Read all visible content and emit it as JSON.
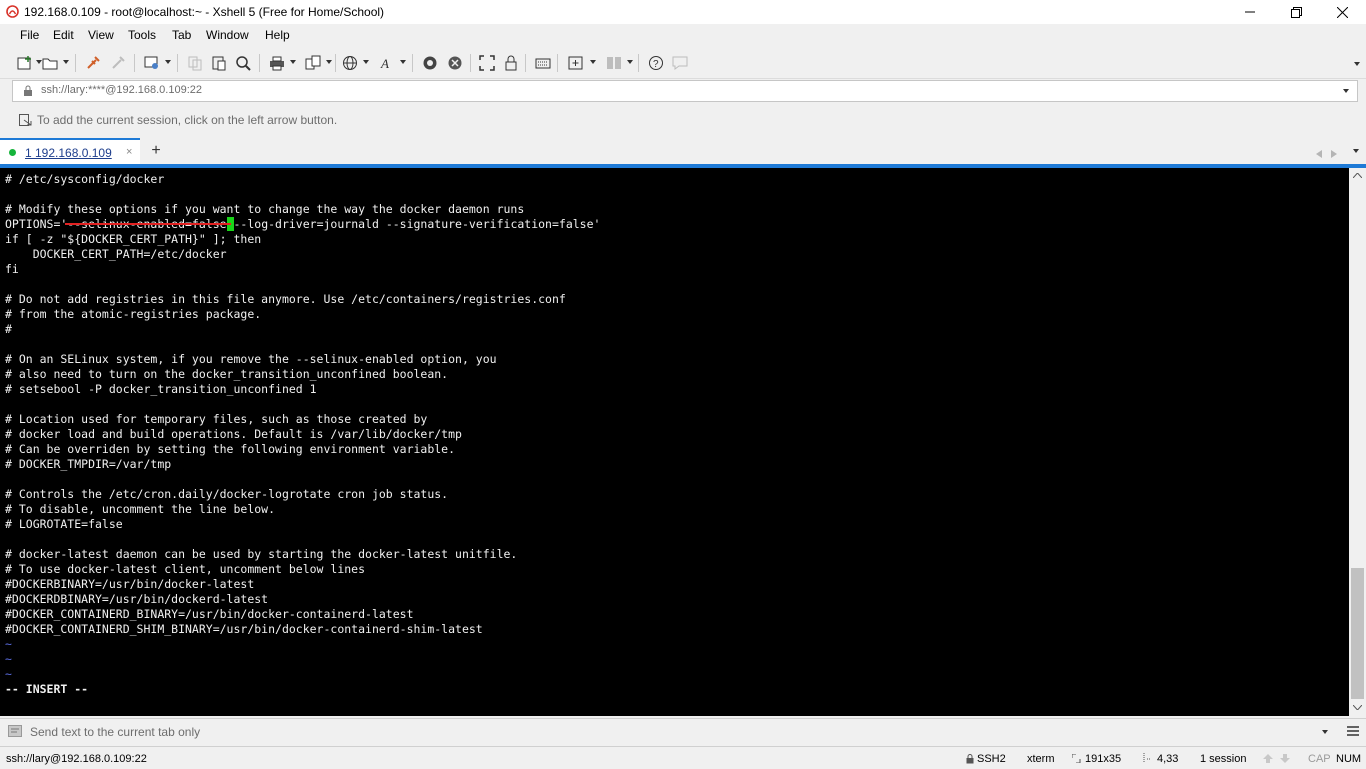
{
  "window": {
    "title": "192.168.0.109 - root@localhost:~ - Xshell 5 (Free for Home/School)"
  },
  "menu": [
    "File",
    "Edit",
    "View",
    "Tools",
    "Tab",
    "Window",
    "Help"
  ],
  "address_bar": {
    "value": "ssh://lary:****@192.168.0.109:22"
  },
  "session_hint": {
    "text": "To add the current session, click on the left arrow button."
  },
  "tabs": [
    {
      "label": "1 192.168.0.109",
      "status_color": "#16b43b"
    }
  ],
  "terminal": {
    "lines": [
      "# /etc/sysconfig/docker",
      "",
      "# Modify these options if you want to change the way the docker daemon runs",
      "OPTIONS='--selinux-enabled=false --log-driver=journald --signature-verification=false'",
      "if [ -z \"${DOCKER_CERT_PATH}\" ]; then",
      "    DOCKER_CERT_PATH=/etc/docker",
      "fi",
      "",
      "# Do not add registries in this file anymore. Use /etc/containers/registries.conf",
      "# from the atomic-registries package.",
      "#",
      "",
      "# On an SELinux system, if you remove the --selinux-enabled option, you",
      "# also need to turn on the docker_transition_unconfined boolean.",
      "# setsebool -P docker_transition_unconfined 1",
      "",
      "# Location used for temporary files, such as those created by",
      "# docker load and build operations. Default is /var/lib/docker/tmp",
      "# Can be overriden by setting the following environment variable.",
      "# DOCKER_TMPDIR=/var/tmp",
      "",
      "# Controls the /etc/cron.daily/docker-logrotate cron job status.",
      "# To disable, uncomment the line below.",
      "# LOGROTATE=false",
      "",
      "# docker-latest daemon can be used by starting the docker-latest unitfile.",
      "# To use docker-latest client, uncomment below lines",
      "#DOCKERBINARY=/usr/bin/docker-latest",
      "#DOCKERDBINARY=/usr/bin/dockerd-latest",
      "#DOCKER_CONTAINERD_BINARY=/usr/bin/docker-containerd-latest",
      "#DOCKER_CONTAINERD_SHIM_BINARY=/usr/bin/docker-containerd-shim-latest"
    ],
    "tilde_lines": [
      "~",
      "~",
      "~"
    ],
    "mode_line": "-- INSERT --",
    "cursor_color": "#19d419",
    "highlight_color": "#e22222"
  },
  "send_bar": {
    "placeholder": "Send text to the current tab only"
  },
  "status": {
    "connection": "ssh://lary@192.168.0.109:22",
    "protocol": "SSH2",
    "terminal_type": "xterm",
    "size": "191x35",
    "cursor_pos": "4,33",
    "sessions": "1 session",
    "caps": "CAP",
    "num": "NUM"
  }
}
